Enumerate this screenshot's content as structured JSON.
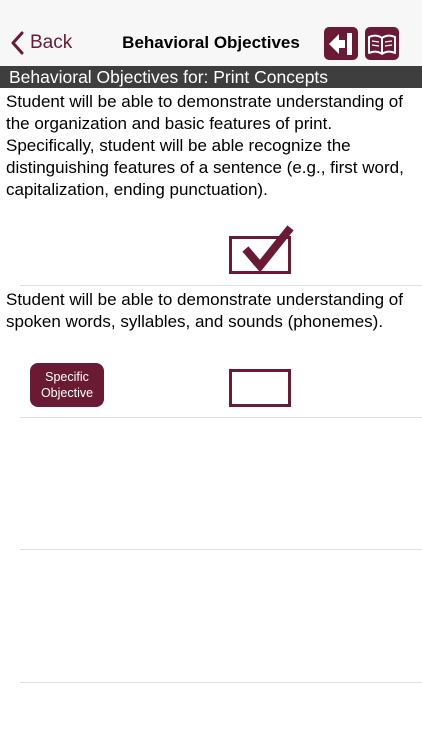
{
  "nav": {
    "back_label": "Back",
    "title": "Behavioral Objectives",
    "icons": [
      "chevron-left-icon",
      "exit-arrow-icon",
      "open-book-icon"
    ]
  },
  "section": {
    "header": "Behavioral Objectives for: Print Concepts"
  },
  "objectives": [
    {
      "text": " Student will be able to demonstrate understanding of the organization and basic features of print. Specifically, student will be able recognize the distinguishing features of a sentence (e.g., first word, capitalization, ending punctuation).",
      "checked": true
    },
    {
      "text": " Student will be able to demonstrate understanding of spoken words, syllables, and sounds (phonemes).",
      "checked": false,
      "button_label": "Specific Objective"
    }
  ],
  "colors": {
    "accent": "#6b1a33",
    "header_bg": "#3e3e3e",
    "nav_bg": "#f7f7f7",
    "divider": "#e0e0e0"
  }
}
